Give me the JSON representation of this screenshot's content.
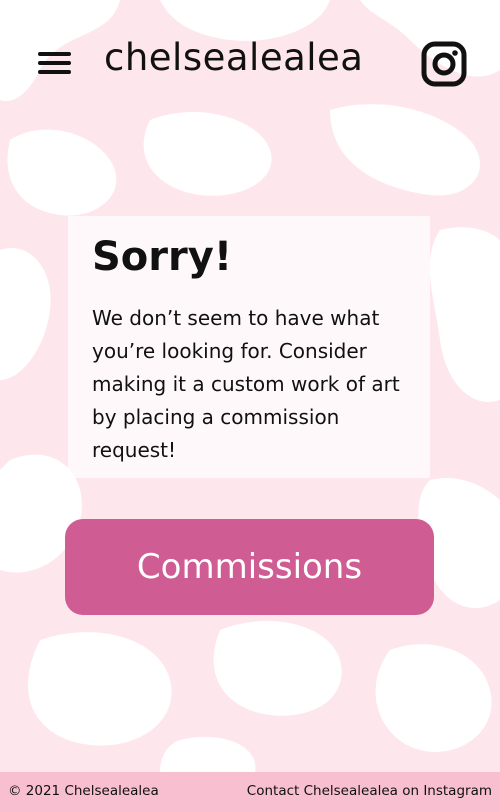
{
  "header": {
    "brand": "chelsealealea",
    "menu_icon": "hamburger-menu-icon",
    "instagram_icon": "instagram-icon"
  },
  "notice": {
    "title": "Sorry!",
    "message": "We don’t seem to have what you’re looking for. Consider making it a custom work of art by placing a commission request!"
  },
  "cta": {
    "label": "Commissions"
  },
  "footer": {
    "copyright": "© 2021 Chelsealealea",
    "contact": "Contact Chelsealealea on Instagram"
  },
  "colors": {
    "background": "#fde6ec",
    "pattern": "#ffffff",
    "button": "#cf5c92",
    "footer": "#f8bfd0",
    "text": "#111111"
  }
}
